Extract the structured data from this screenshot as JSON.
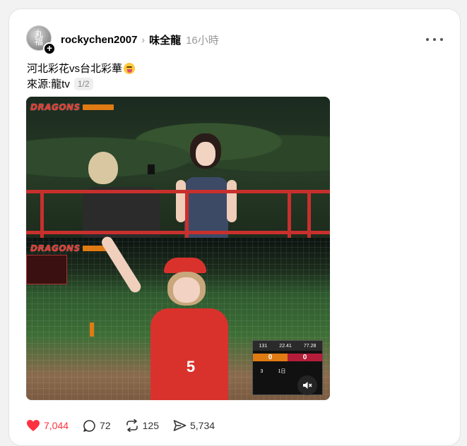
{
  "post": {
    "avatar_text": "丸\n福",
    "username": "rockychen2007",
    "separator": "›",
    "topic": "味全龍",
    "timestamp": "16小時",
    "text_line1": "河北彩花vs台北彩華",
    "text_line2": "來源:龍tv",
    "page_indicator": "1/2"
  },
  "media": {
    "brand": "DRAGONS",
    "scoreboard": {
      "stats": [
        "131",
        "22.41",
        "77.28"
      ],
      "team_scores": [
        "0",
        "0"
      ],
      "inning": "3",
      "half": "1日"
    },
    "jersey_number": "5"
  },
  "actions": {
    "likes": "7,044",
    "comments": "72",
    "reposts": "125",
    "shares": "5,734"
  },
  "colors": {
    "like": "#ff3040",
    "text_muted": "#999999"
  }
}
